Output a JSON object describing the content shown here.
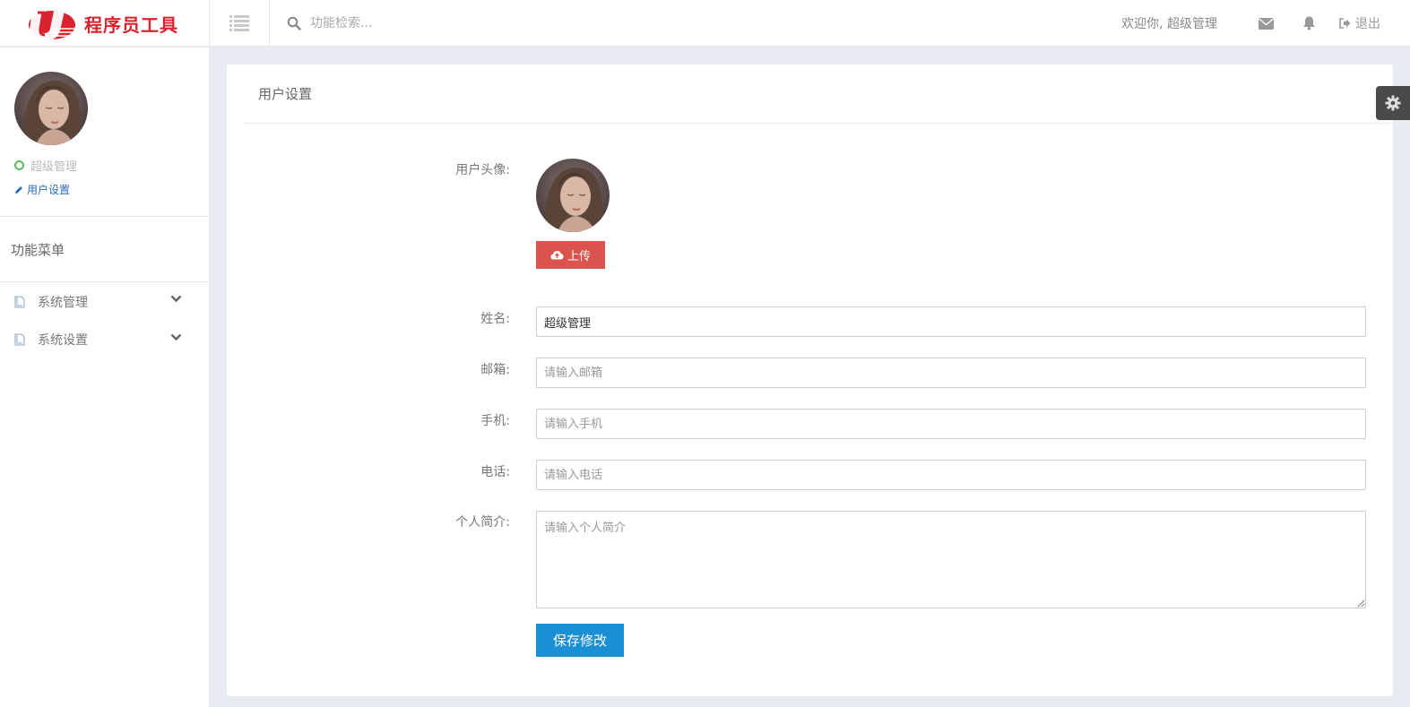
{
  "brand": {
    "name": "程序员工具",
    "color": "#d9232e"
  },
  "topbar": {
    "search_placeholder": "功能检索...",
    "welcome": "欢迎你, 超级管理",
    "logout_label": "退出",
    "icons": [
      "menu-list-icon",
      "search-icon",
      "envelope-icon",
      "bell-icon",
      "sign-out-icon"
    ]
  },
  "sidebar": {
    "user_name": "超级管理",
    "user_settings_label": "用户设置",
    "menu_title": "功能菜单",
    "items": [
      {
        "label": "系统管理"
      },
      {
        "label": "系统设置"
      }
    ]
  },
  "main": {
    "panel_title": "用户设置",
    "avatar_label": "用户头像:",
    "upload_label": "上传",
    "fields": {
      "name": {
        "label": "姓名:",
        "value": "超级管理"
      },
      "email": {
        "label": "邮箱:",
        "placeholder": "请输入邮箱"
      },
      "mobile": {
        "label": "手机:",
        "placeholder": "请输入手机"
      },
      "phone": {
        "label": "电话:",
        "placeholder": "请输入电话"
      },
      "bio": {
        "label": "个人简介:",
        "placeholder": "请输入个人简介"
      }
    },
    "save_label": "保存修改"
  },
  "colors": {
    "upload_button": "#d9534f",
    "save_button": "#1a8fd4",
    "online_status": "#5cb85c",
    "link": "#2a6ebb"
  }
}
